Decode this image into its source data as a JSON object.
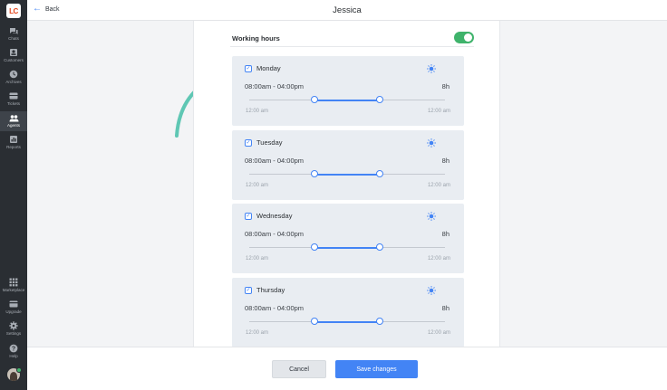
{
  "app": {
    "logo_text": "LC",
    "accent": "#4384f5",
    "success": "#3fb36b"
  },
  "nav": {
    "top_items": [
      {
        "label": "Chats",
        "icon": "chat-icon"
      },
      {
        "label": "Customers",
        "icon": "customers-icon"
      },
      {
        "label": "Archives",
        "icon": "archives-icon"
      },
      {
        "label": "Tickets",
        "icon": "tickets-icon"
      },
      {
        "label": "Agents",
        "icon": "agents-icon",
        "active": true
      },
      {
        "label": "Reports",
        "icon": "reports-icon"
      }
    ],
    "bottom_items": [
      {
        "label": "Marketplace",
        "icon": "grid-icon"
      },
      {
        "label": "Upgrade",
        "icon": "card-icon"
      },
      {
        "label": "Settings",
        "icon": "gear-icon"
      },
      {
        "label": "Help",
        "icon": "help-icon"
      }
    ]
  },
  "header": {
    "back_label": "Back",
    "title": "Jessica"
  },
  "working_hours": {
    "label": "Working hours",
    "enabled": true,
    "days": [
      {
        "name": "Monday",
        "hours": "08:00am - 04:00pm",
        "duration": "8h",
        "start_label": "12:00 am",
        "end_label": "12:00 am",
        "checked": true
      },
      {
        "name": "Tuesday",
        "hours": "08:00am - 04:00pm",
        "duration": "8h",
        "start_label": "12:00 am",
        "end_label": "12:00 am",
        "checked": true
      },
      {
        "name": "Wednesday",
        "hours": "08:00am - 04:00pm",
        "duration": "8h",
        "start_label": "12:00 am",
        "end_label": "12:00 am",
        "checked": true
      },
      {
        "name": "Thursday",
        "hours": "08:00am - 04:00pm",
        "duration": "8h",
        "start_label": "12:00 am",
        "end_label": "12:00 am",
        "checked": true
      }
    ]
  },
  "footer": {
    "cancel_label": "Cancel",
    "save_label": "Save changes"
  }
}
